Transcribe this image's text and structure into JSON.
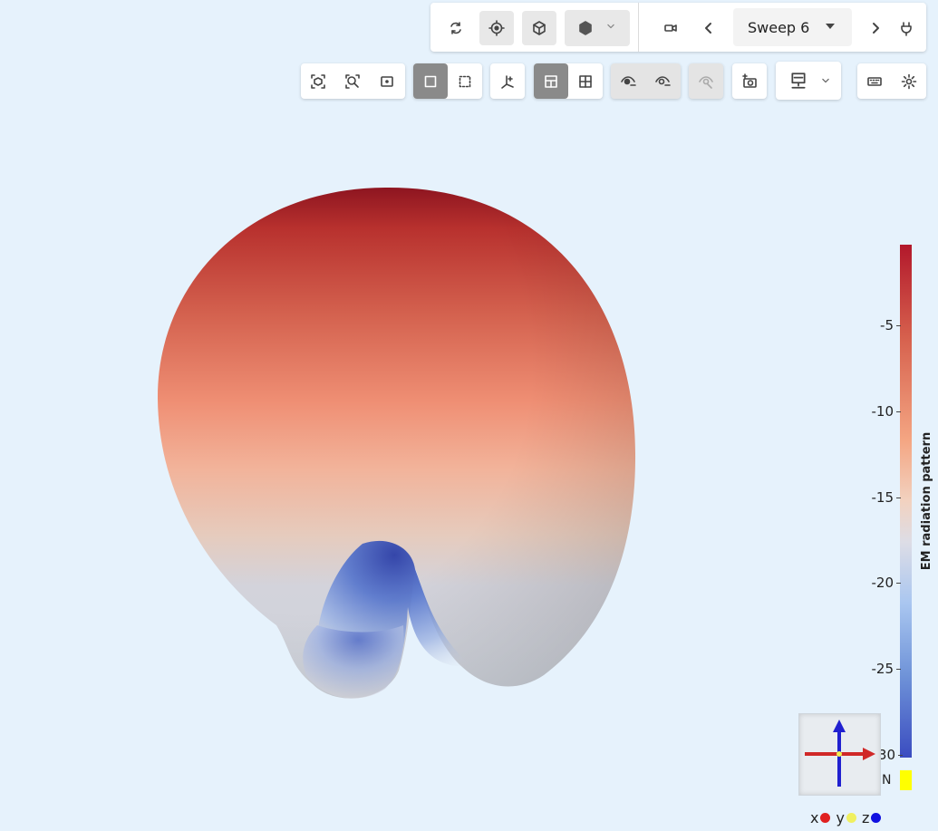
{
  "toolbar_top": {
    "sweep_label": "Sweep 6"
  },
  "colorbar": {
    "title": "EM radiation pattern",
    "ticks": [
      "-5",
      "-10",
      "-15",
      "-20",
      "-25",
      "30"
    ],
    "nan_label": "NaN",
    "colors": {
      "high": "#b2182b",
      "mid": "#f4a582",
      "neutral": "#dddde6",
      "low": "#3a4cc0",
      "nan": "#ffff00"
    }
  },
  "axes_legend": {
    "x_label": "x",
    "y_label": "y",
    "z_label": "z",
    "x_color": "#e02020",
    "y_color": "#f0f060",
    "z_color": "#1010e0"
  }
}
